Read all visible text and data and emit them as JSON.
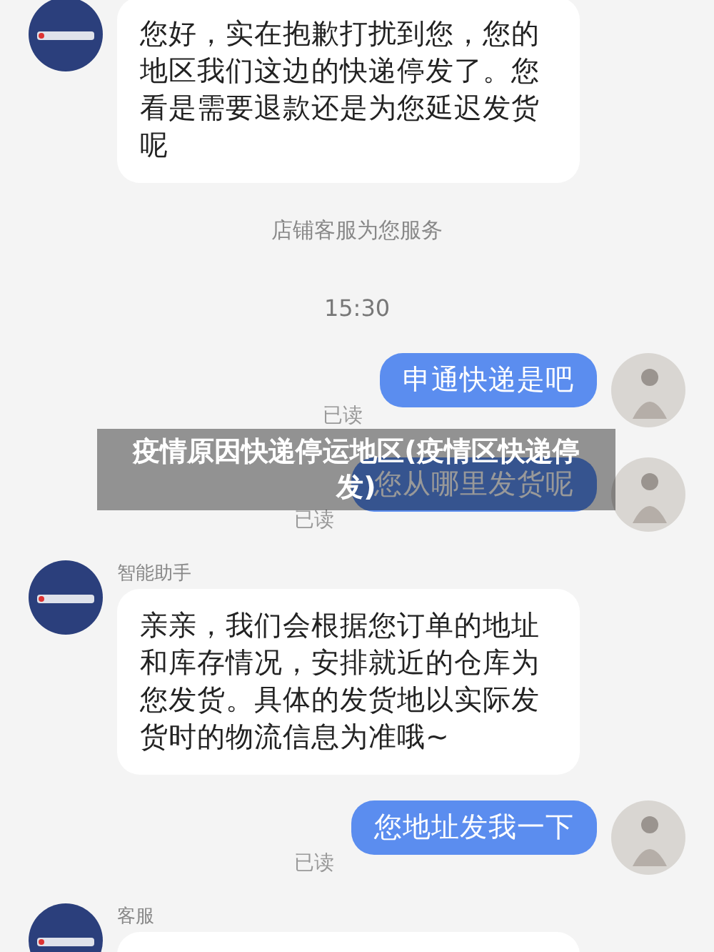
{
  "messages": [
    {
      "kind": "incoming",
      "text": "您好，实在抱歉打扰到您，您的地区我们这边的快递停发了。您看是需要退款还是为您延迟发货呢"
    },
    {
      "kind": "system",
      "text": "店铺客服为您服务"
    },
    {
      "kind": "time",
      "text": "15:30"
    },
    {
      "kind": "outgoing",
      "text": "申通快递是吧",
      "status": "已读"
    },
    {
      "kind": "outgoing",
      "text": "您从哪里发货呢",
      "status": "已读"
    },
    {
      "kind": "incoming",
      "sender": "智能助手",
      "text": "亲亲，我们会根据您订单的地址和库存情况，安排就近的仓库为您发货。具体的发货地以实际发货时的物流信息为准哦~"
    },
    {
      "kind": "outgoing",
      "text": "您地址发我一下",
      "status": "已读"
    },
    {
      "kind": "incoming",
      "sender": "客服"
    }
  ],
  "banner": {
    "text": "疫情原因快递停运地区(疫情区快递停发)"
  }
}
